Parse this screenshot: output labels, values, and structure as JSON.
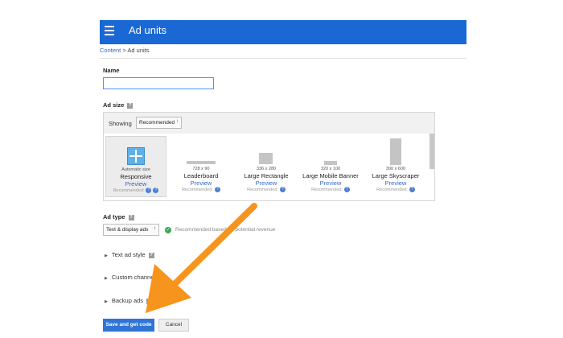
{
  "header": {
    "title": "Ad units",
    "menu_icon": "hamburger-menu-icon",
    "color": "#1a68d4"
  },
  "breadcrumb": {
    "parent": "Content",
    "separator": " > ",
    "current": "Ad units"
  },
  "name_field": {
    "label": "Name",
    "value": "",
    "placeholder": ""
  },
  "ad_size": {
    "label": "Ad size",
    "showing_label": "Showing",
    "showing_value": "Recommended",
    "options": [
      {
        "size": "Automatic size",
        "name": "Responsive",
        "preview": "Preview",
        "recommended": "Recommended:"
      },
      {
        "size": "728 x 90",
        "name": "Leaderboard",
        "preview": "Preview",
        "recommended": "Recommended:"
      },
      {
        "size": "336 x 280",
        "name": "Large Rectangle",
        "preview": "Preview",
        "recommended": "Recommended:"
      },
      {
        "size": "320 x 100",
        "name": "Large Mobile Banner",
        "preview": "Preview",
        "recommended": "Recommended:"
      },
      {
        "size": "300 x 600",
        "name": "Large Skyscraper",
        "preview": "Preview",
        "recommended": "Recommended:"
      }
    ]
  },
  "ad_type": {
    "label": "Ad type",
    "value": "Text & display ads",
    "recommendation": "Recommended based on potential revenue"
  },
  "sections": [
    "Text ad style",
    "Custom channels",
    "Backup ads"
  ],
  "actions": {
    "save": "Save and get code",
    "cancel": "Cancel"
  },
  "colors": {
    "accent": "#1a68d4",
    "annotation_arrow": "#f7941d",
    "success": "#3aa757"
  }
}
